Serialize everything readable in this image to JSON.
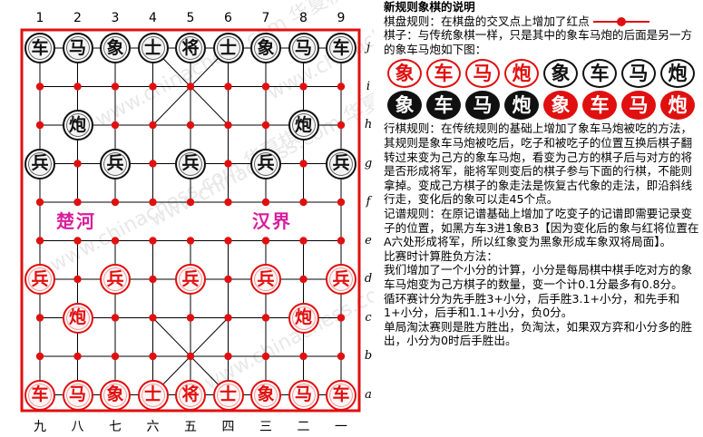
{
  "board": {
    "file_labels_top": [
      "1",
      "2",
      "3",
      "4",
      "5",
      "6",
      "7",
      "8",
      "9"
    ],
    "file_labels_bottom": [
      "九",
      "八",
      "七",
      "六",
      "五",
      "四",
      "三",
      "二",
      "一"
    ],
    "rank_labels": [
      "j",
      "i",
      "h",
      "g",
      "f",
      "e",
      "d",
      "c",
      "b",
      "a"
    ],
    "river_left": "楚河",
    "river_right": "汉界",
    "watermark": "www.chinachess.com 华夏棋坛",
    "black_back": [
      "车",
      "马",
      "象",
      "士",
      "将",
      "士",
      "象",
      "马",
      "车"
    ],
    "black_cannon": "炮",
    "black_soldier": "兵",
    "red_back": [
      "车",
      "马",
      "象",
      "士",
      "将",
      "士",
      "象",
      "马",
      "车"
    ],
    "red_cannon": "炮",
    "red_soldier": "兵"
  },
  "rules": {
    "title": "新规则象棋的说明",
    "board_rule": "棋盘规则：在棋盘的交叉点上增加了红点",
    "pieces_rule": "棋子：与传统象棋一样，只是其中的象车马炮的后面是另一方的象车马炮如下图：",
    "samples_row1": [
      "象",
      "车",
      "马",
      "炮",
      "象",
      "车",
      "马",
      "炮"
    ],
    "samples_row2": [
      "象",
      "车",
      "马",
      "炮",
      "象",
      "车",
      "马",
      "炮"
    ],
    "move_rule": "行棋规则：在传统规则的基础上增加了象车马炮被吃的方法，其规则是象车马炮被吃后，吃子和被吃子的位置互换后棋子翻转过来变为己方的象车马炮，看变为己方的棋子后与对方的将是否形成将军，能将军则变后的棋子参与下面的行棋，不能则拿掉。变成己方棋子的象走法是恢复古代象的走法，即沿斜线行走，变化后的象可以走45个点。",
    "record_rule": "记谱规则：在原记谱基础上增加了吃变子的记谱即需要记录变子的位置，如黑方车3进1象B3【因为变化后的象与红将位置在A六处形成将军，所以红象变为黑象形成车象双将局面】。",
    "scoring_title": "比赛时计算胜负方法：",
    "scoring_rule": "我们增加了一个小分的计算，小分是每局棋中棋手吃对方的象车马炮变为己方棋子的数量，变一个计0.1分最多有0.8分。",
    "round_robin": "循环赛计分为先手胜3+小分，后手胜3.1+小分，和先手和1+小分，后手和1.1+小分，负0分。",
    "knockout": "单局淘汰赛则是胜方胜出，负淘汰，如果双方弈和小分多的胜出，小分为0时后手胜出。"
  },
  "colors": {
    "red": "#e01010",
    "black": "#111111",
    "river_text": "#d91e9c",
    "board_border": "#e01010"
  }
}
